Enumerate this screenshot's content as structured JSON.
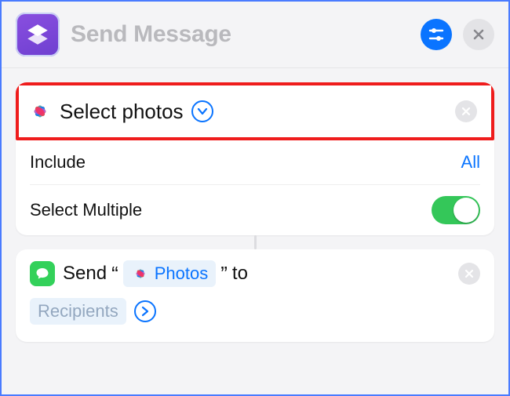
{
  "header": {
    "title": "Send Message"
  },
  "action_select_photos": {
    "label": "Select photos",
    "include_label": "Include",
    "include_value": "All",
    "select_multiple_label": "Select Multiple",
    "select_multiple_on": true
  },
  "action_send": {
    "prefix": "Send",
    "open_quote": "“",
    "photos_token": "Photos",
    "close_quote": "”",
    "to_label": "to",
    "recipients_token": "Recipients"
  },
  "colors": {
    "accent_blue": "#0a74ff",
    "toggle_green": "#34c759",
    "highlight_red": "#ef1c1c"
  }
}
